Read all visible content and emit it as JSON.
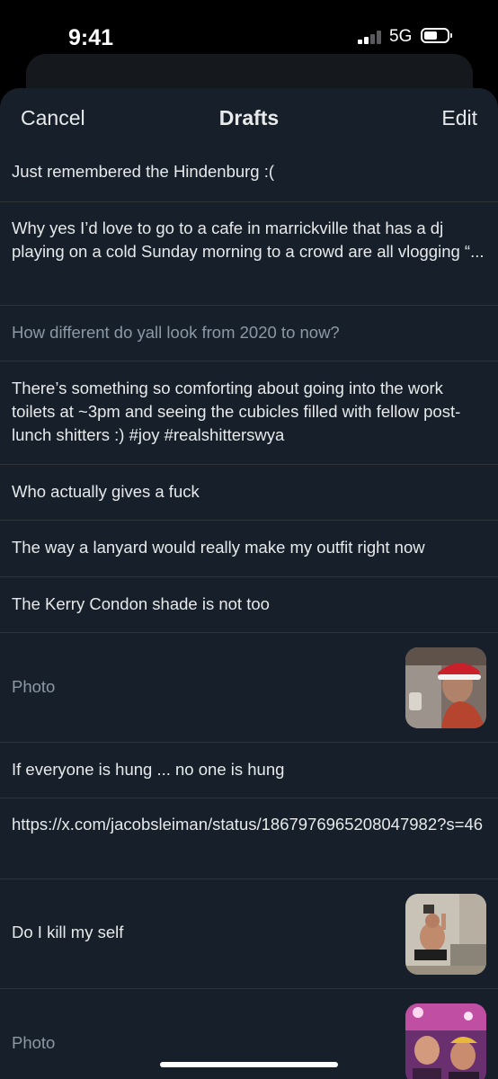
{
  "status_bar": {
    "time": "9:41",
    "network": "5G"
  },
  "nav": {
    "cancel_label": "Cancel",
    "title": "Drafts",
    "edit_label": "Edit"
  },
  "drafts": [
    {
      "text": "Just remembered the Hindenburg :("
    },
    {
      "text": "Why yes I’d love to go to a cafe in marrickville  that has a dj playing on a cold Sunday morning to a crowd are all vlogging “..."
    },
    {
      "text": "How different do yall look from 2020 to now?"
    },
    {
      "text": "There’s something so comforting about going into the work toilets at ~3pm and seeing the cubicles filled with fellow post-lunch shitters :) #joy #realshitterswya"
    },
    {
      "text": "Who actually gives a fuck"
    },
    {
      "text": "The way a lanyard would really make my outfit right now"
    },
    {
      "text": "The Kerry Condon shade is not too"
    },
    {
      "text": "Photo"
    },
    {
      "text": "If everyone is hung ... no one is hung"
    },
    {
      "text": "https://x.com/jacobsleiman/status/1867976965208047982?s=46"
    },
    {
      "text": "Do I kill my self"
    },
    {
      "text": "Photo"
    }
  ],
  "colors": {
    "sheet_background": "#17202a",
    "divider": "#2f3336",
    "primary_text": "#e7e9ea",
    "muted_text": "#8b98a5"
  },
  "icons": [
    "signal-icon",
    "battery-icon"
  ]
}
